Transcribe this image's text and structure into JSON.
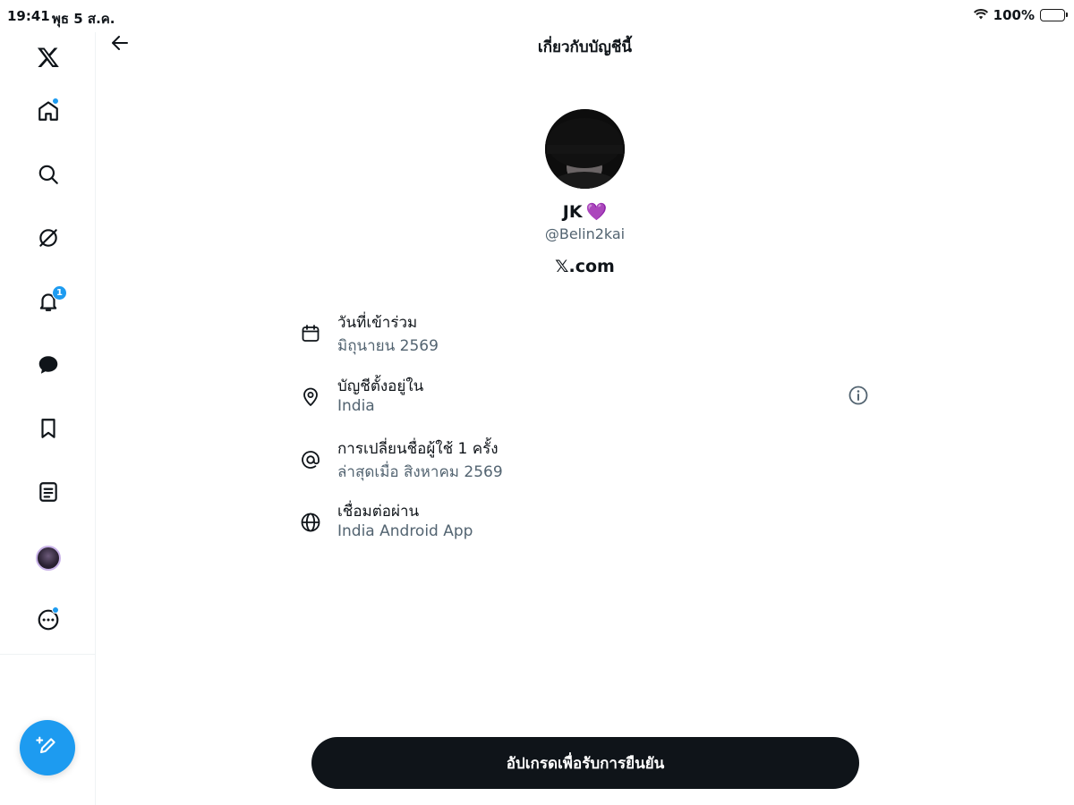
{
  "status_bar": {
    "time": "19:41",
    "date": "พุธ 5 ส.ค.",
    "battery": "100%"
  },
  "header": {
    "title": "เกี่ยวกับบัญชีนี้"
  },
  "sidebar": {
    "items": [
      {
        "name": "logo",
        "icon": "x-logo-icon"
      },
      {
        "name": "home",
        "icon": "home-icon",
        "has_dot": true
      },
      {
        "name": "explore",
        "icon": "search-icon"
      },
      {
        "name": "grok",
        "icon": "grok-icon"
      },
      {
        "name": "notifications",
        "icon": "bell-icon",
        "badge": "1"
      },
      {
        "name": "messages",
        "icon": "message-icon"
      },
      {
        "name": "bookmarks",
        "icon": "bookmark-icon"
      },
      {
        "name": "lists",
        "icon": "list-icon"
      },
      {
        "name": "profile",
        "icon": "avatar"
      },
      {
        "name": "more",
        "icon": "more-icon",
        "has_dot": true
      }
    ],
    "compose": {
      "icon": "compose-icon"
    }
  },
  "profile": {
    "name": "JK",
    "emoji": "💜",
    "handle": "@Belin2kai",
    "source": "𝕏.com"
  },
  "info": [
    {
      "icon": "calendar-icon",
      "title": "วันที่เข้าร่วม",
      "value": "มิถุนายน 2569"
    },
    {
      "icon": "location-icon",
      "title": "บัญชีตั้งอยู่ใน",
      "value": "India",
      "help_icon": "info-icon"
    },
    {
      "icon": "at-icon",
      "title": "การเปลี่ยนชื่อผู้ใช้ 1 ครั้ง",
      "value": "ล่าสุดเมื่อ สิงหาคม 2569"
    },
    {
      "icon": "globe-icon",
      "title": "เชื่อมต่อผ่าน",
      "value": "India Android App"
    }
  ],
  "upgrade_button": {
    "label": "อัปเกรดเพื่อรับการยืนยัน"
  },
  "colors": {
    "accent": "#1d9bf0",
    "text_primary": "#0f1419",
    "text_secondary": "#536471",
    "button_bg": "#0f1419",
    "heart": "#a85fe0"
  }
}
